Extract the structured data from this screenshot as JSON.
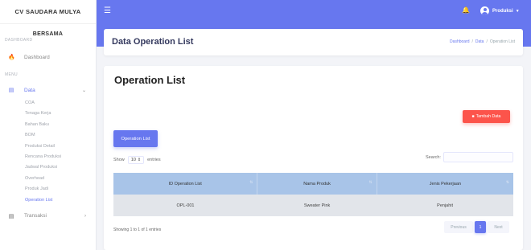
{
  "sidebar": {
    "brand": "CV SAUDARA MULYA",
    "brand_short": "BERSAMA",
    "section_dashboard": "DASHBOARD",
    "dashboard": "Dashboard",
    "section_menu": "MENU",
    "data": "Data",
    "data_items": [
      "COA",
      "Tenaga Kerja",
      "Bahan Baku",
      "BOM",
      "Produksi Detail",
      "Rencana Produksi",
      "Jadwal Produksi",
      "Overhead",
      "Produk Jadi",
      "Operation List"
    ],
    "transaksi": "Transaksi",
    "active_item": "Operation List"
  },
  "topbar": {
    "user": "Produksi"
  },
  "header": {
    "title": "Data Operation List",
    "breadcrumbs": [
      "Dashboard",
      "Data",
      "Operation List"
    ]
  },
  "card": {
    "title": "Operation List",
    "add_button": "Tambah Data",
    "tab_button": "Operation List",
    "show_label": "Show",
    "entries_value": "10",
    "entries_label": "entries",
    "search_label": "Search:"
  },
  "table": {
    "columns": [
      "ID Operation List",
      "Nama Produk",
      "Jenis Pekerjaan"
    ],
    "rows": [
      [
        "OPL-001",
        "Sweater Pink",
        "Penjahit"
      ]
    ]
  },
  "footer": {
    "info": "Showing 1 to 1 of 1 entries",
    "previous": "Previous",
    "page": "1",
    "next": "Next"
  },
  "colors": {
    "primary": "#6777ef",
    "danger": "#fc544b",
    "table_header": "#a8c4e8",
    "table_row": "#e2e5ea"
  }
}
